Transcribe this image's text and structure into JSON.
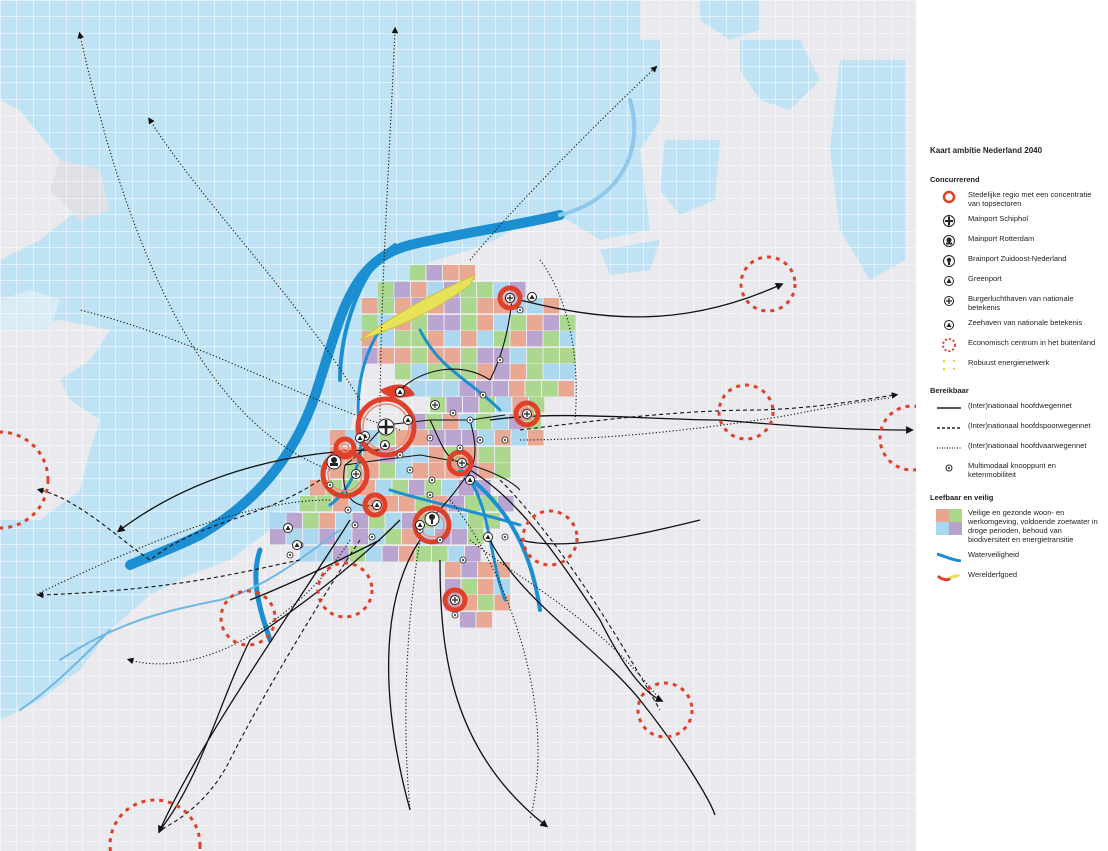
{
  "legend": {
    "title": "Kaart ambitie Nederland 2040",
    "sections": [
      {
        "heading": "Concurrerend",
        "items": [
          {
            "symbol": "red-ring-icon",
            "text": "Stedelijke regio met een concentratie van topsectoren"
          },
          {
            "symbol": "plane-icon",
            "text": "Mainport Schiphol"
          },
          {
            "symbol": "port-icon",
            "text": "Mainport Rotterdam"
          },
          {
            "symbol": "lightbulb-icon",
            "text": "Brainport Zuidoost-Nederland"
          },
          {
            "symbol": "greenhouse-icon",
            "text": "Greenport"
          },
          {
            "symbol": "small-plane-icon",
            "text": "Burgerluchthaven van nationale betekenis"
          },
          {
            "symbol": "ship-icon",
            "text": "Zeehaven van nationale betekenis"
          },
          {
            "symbol": "dotted-red-circle-icon",
            "text": "Economisch centrum in het buitenland"
          },
          {
            "symbol": "energy-dots-icon",
            "text": "Robuust energienetwerk"
          }
        ]
      },
      {
        "heading": "Bereikbaar",
        "items": [
          {
            "symbol": "solid-line-icon",
            "text": "(Inter)nationaal hoofdwegennet"
          },
          {
            "symbol": "dashed-line-icon",
            "text": "(Inter)nationaal hoofdspoorwegennet"
          },
          {
            "symbol": "dotted-line-icon",
            "text": "(Inter)nationaal hoofdvaarwegennet"
          },
          {
            "symbol": "node-icon",
            "text": "Multimodaal knooppunt en ketenmobiliteit"
          }
        ]
      },
      {
        "heading": "Leefbaar en veilig",
        "items": [
          {
            "symbol": "color-checker-icon",
            "text": "Veilige en gezonde woon- en werkomgeving, voldoende zoetwater in droge perioden, behoud van biodiversiteit en energietransitie"
          },
          {
            "symbol": "blue-stroke-icon",
            "text": "Waterveiligheid"
          },
          {
            "symbol": "yellow-red-stroke-icon",
            "text": "Werelderfgoed"
          }
        ]
      }
    ]
  },
  "colors": {
    "sea": "#bfe3f4",
    "land": "#e9e9ee",
    "grid": "#ffffff",
    "red": "#e0402a",
    "blue": "#1b8fd2",
    "checker": [
      "#e8a58f",
      "#a9d78a",
      "#b7a2cf",
      "#a8d8f0"
    ],
    "heritage": "#e8e25a"
  }
}
